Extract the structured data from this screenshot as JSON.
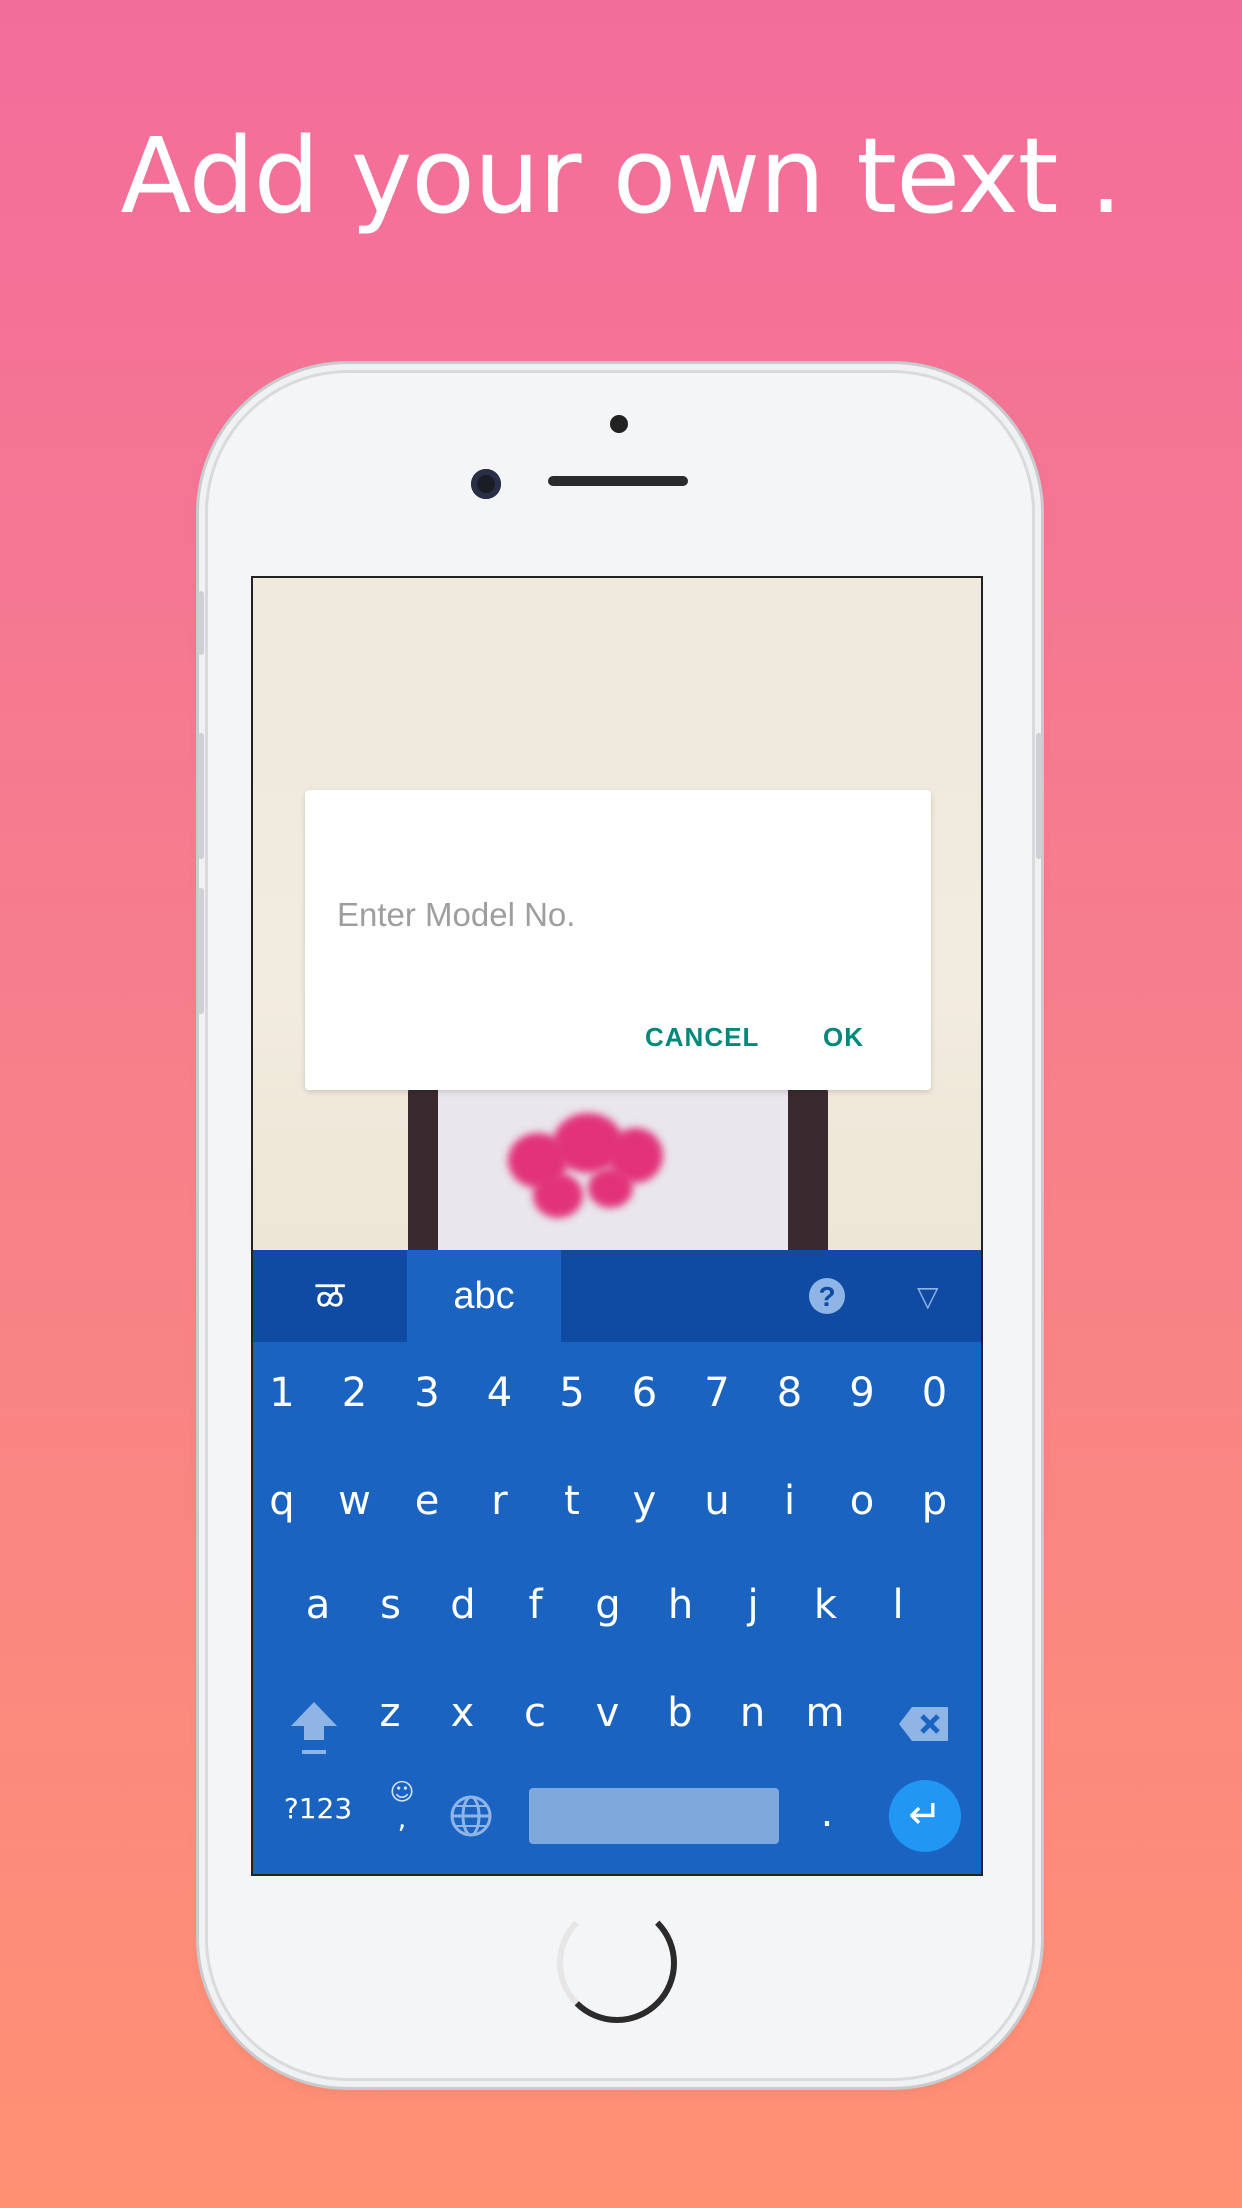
{
  "headline": "Add your own text .",
  "dialog": {
    "placeholder": "Enter Model No.",
    "cancel_label": "CANCEL",
    "ok_label": "OK"
  },
  "keyboard": {
    "lang_tab": "ळ",
    "abc_tab": "abc",
    "help_glyph": "?",
    "hide_glyph": "▽",
    "row_numbers": [
      "1",
      "2",
      "3",
      "4",
      "5",
      "6",
      "7",
      "8",
      "9",
      "0"
    ],
    "row1": [
      "q",
      "w",
      "e",
      "r",
      "t",
      "y",
      "u",
      "i",
      "o",
      "p"
    ],
    "row2": [
      "a",
      "s",
      "d",
      "f",
      "g",
      "h",
      "j",
      "k",
      "l"
    ],
    "row3": [
      "z",
      "x",
      "c",
      "v",
      "b",
      "n",
      "m"
    ],
    "symbols_key": "?123",
    "emoji_glyph": "☺",
    "comma_key": ",",
    "period_key": ".",
    "enter_glyph": "↵"
  },
  "colors": {
    "accent": "#00897b",
    "keyboard": "#1a63c0",
    "keyboard_top": "#0f4ba3",
    "enter": "#2196f3"
  }
}
